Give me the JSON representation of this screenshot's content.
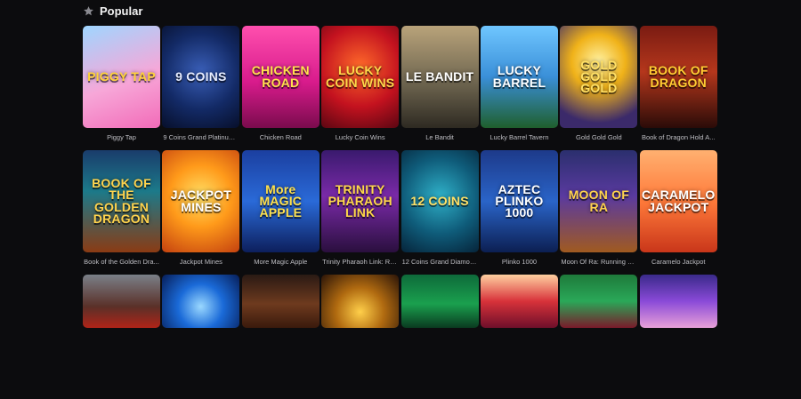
{
  "section": {
    "title": "Popular",
    "icon": "star-icon"
  },
  "games": [
    {
      "name": "Piggy Tap",
      "logo": "PIGGY TAP",
      "bg": "linear-gradient(160deg,#9fd6ff 0%,#f7a7d8 55%,#f26bb8 100%)",
      "fg": "#ffd23a"
    },
    {
      "name": "9 Coins Grand Platinum...",
      "logo": "9 COINS",
      "bg": "radial-gradient(circle at 50% 45%,#3a5fb8 0%,#132a66 55%,#070f2a 100%)",
      "fg": "#e6ecff"
    },
    {
      "name": "Chicken Road",
      "logo": "CHICKEN ROAD",
      "bg": "linear-gradient(180deg,#ff4fae 0%,#d81b8c 55%,#7a0b4d 100%)",
      "fg": "#ffe14d"
    },
    {
      "name": "Lucky Coin Wins",
      "logo": "LUCKY COIN WINS",
      "bg": "radial-gradient(circle at 50% 40%,#ff6a2a 0%,#c4121f 55%,#5b0612 100%)",
      "fg": "#ffd84a"
    },
    {
      "name": "Le Bandit",
      "logo": "LE BANDIT",
      "bg": "linear-gradient(180deg,#b9a37a 0%,#6f6650 55%,#2e2a22 100%)",
      "fg": "#ffffff"
    },
    {
      "name": "Lucky Barrel Tavern",
      "logo": "LUCKY BARREL",
      "bg": "linear-gradient(180deg,#6fc6ff 0%,#3a8fd8 50%,#1f5f2c 100%)",
      "fg": "#ffffff"
    },
    {
      "name": "Gold Gold Gold",
      "logo": "GOLD GOLD GOLD",
      "bg": "radial-gradient(circle at 50% 35%,#fff1a0 0%,#f0b219 35%,#3b2a6a 80%)",
      "fg": "#ffe066"
    },
    {
      "name": "Book of Dragon Hold A...",
      "logo": "BOOK OF DRAGON",
      "bg": "linear-gradient(180deg,#7a1b12 0%,#b5371c 45%,#2a0b08 100%)",
      "fg": "#ffcc33"
    },
    {
      "name": "Book of the Golden Dra...",
      "logo": "BOOK OF THE GOLDEN DRAGON",
      "bg": "linear-gradient(180deg,#1a3c6b 0%,#1c7a8a 40%,#8a3b14 100%)",
      "fg": "#ffd34d"
    },
    {
      "name": "Jackpot Mines",
      "logo": "JACKPOT MINES",
      "bg": "radial-gradient(circle at 50% 45%,#ffe066 0%,#ff9a1a 45%,#c4410f 100%)",
      "fg": "#ffffff"
    },
    {
      "name": "More Magic Apple",
      "logo": "More MAGIC APPLE",
      "bg": "linear-gradient(180deg,#1b3fa0 0%,#2a6ad8 50%,#0d1f5c 100%)",
      "fg": "#ffe14d"
    },
    {
      "name": "Trinity Pharaoh Link: Ru...",
      "logo": "TRINITY PHARAOH LINK",
      "bg": "linear-gradient(180deg,#3a1a6e 0%,#7a2aa8 45%,#2a0f3e 100%)",
      "fg": "#ffd84a"
    },
    {
      "name": "12 Coins Grand Diamon...",
      "logo": "12 COINS",
      "bg": "radial-gradient(circle at 50% 45%,#2fb0c8 0%,#0f5c7a 55%,#06243a 100%)",
      "fg": "#ffe066"
    },
    {
      "name": "Plinko 1000",
      "logo": "AZTEC PLINKO 1000",
      "bg": "linear-gradient(180deg,#1d3a8a 0%,#2a64c8 50%,#0c1f52 100%)",
      "fg": "#ffffff"
    },
    {
      "name": "Moon Of Ra: Running W...",
      "logo": "MOON OF RA",
      "bg": "linear-gradient(180deg,#2b2f6e 0%,#5a3aa0 45%,#a05a20 100%)",
      "fg": "#ffd34d"
    },
    {
      "name": "Caramelo Jackpot",
      "logo": "CARAMELO JACKPOT",
      "bg": "linear-gradient(180deg,#ffb070 0%,#ff7a3a 50%,#c9361a 100%)",
      "fg": "#ffffff"
    },
    {
      "name": "",
      "logo": "",
      "bg": "linear-gradient(180deg,#7a8088 0%,#5a3028 60%,#b02418 100%)",
      "fg": "#ffffff"
    },
    {
      "name": "",
      "logo": "",
      "bg": "radial-gradient(circle at 50% 60%,#9ad8ff 0%,#1a6ad8 45%,#071e58 100%)",
      "fg": "#ffffff"
    },
    {
      "name": "",
      "logo": "",
      "bg": "linear-gradient(180deg,#2a1a14 0%,#6e3a1e 55%,#3a1a0c 100%)",
      "fg": "#ffffff"
    },
    {
      "name": "",
      "logo": "",
      "bg": "radial-gradient(circle at 50% 70%,#ffcf4a 0%,#b06a10 45%,#2a1408 100%)",
      "fg": "#ffffff"
    },
    {
      "name": "",
      "logo": "",
      "bg": "linear-gradient(180deg,#0e6a3a 0%,#1aa04e 55%,#0a3a20 100%)",
      "fg": "#ffffff"
    },
    {
      "name": "",
      "logo": "",
      "bg": "linear-gradient(180deg,#ffd0a0 0%,#d8323a 50%,#6e0f2a 100%)",
      "fg": "#ffffff"
    },
    {
      "name": "",
      "logo": "",
      "bg": "linear-gradient(180deg,#1e7a3a 0%,#2aa858 50%,#7a1a2a 100%)",
      "fg": "#ffffff"
    },
    {
      "name": "",
      "logo": "",
      "bg": "linear-gradient(180deg,#3a2a8a 0%,#8a4ad8 50%,#e8a0d8 100%)",
      "fg": "#ffffff"
    }
  ]
}
